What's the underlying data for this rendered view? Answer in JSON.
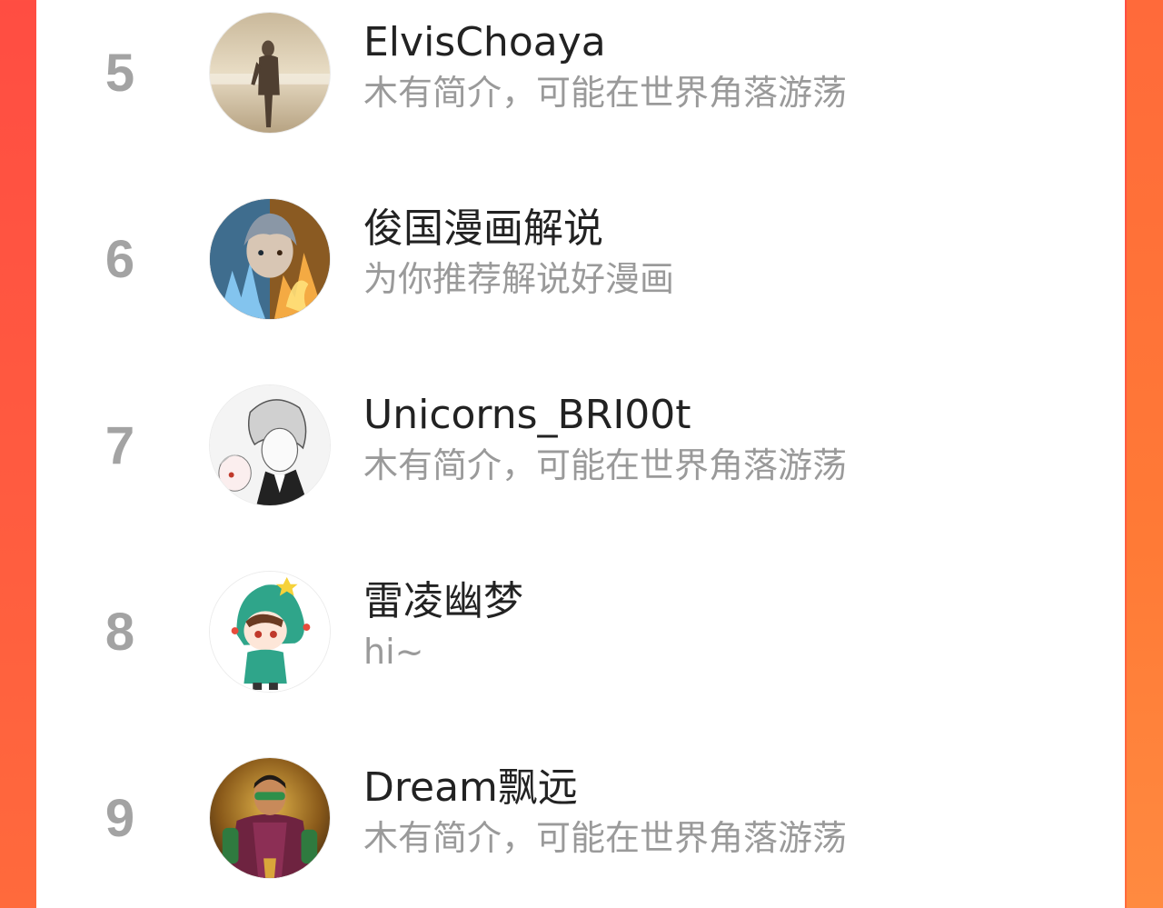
{
  "colors": {
    "background_left": "#ff4d42",
    "background_right": "#ff7a36",
    "card": "#ffffff",
    "rank": "#a3a3a3",
    "name": "#222222",
    "bio": "#9a9a9a"
  },
  "ranking": {
    "items": [
      {
        "rank": "5",
        "name": "ElvisChoaya",
        "bio": "木有简介，可能在世界角落游荡",
        "avatar_icon": "silhouette-beach-avatar"
      },
      {
        "rank": "6",
        "name": "俊国漫画解说",
        "bio": "为你推荐解说好漫画",
        "avatar_icon": "ice-fire-anime-avatar"
      },
      {
        "rank": "7",
        "name": "Unicorns_BRI00t",
        "bio": "木有简介，可能在世界角落游荡",
        "avatar_icon": "manga-sketch-avatar"
      },
      {
        "rank": "8",
        "name": "雷凌幽梦",
        "bio": "hi~",
        "avatar_icon": "chibi-green-hood-avatar"
      },
      {
        "rank": "9",
        "name": "Dream飘远",
        "bio": "木有简介，可能在世界角落游荡",
        "avatar_icon": "hero-masked-avatar"
      }
    ]
  }
}
